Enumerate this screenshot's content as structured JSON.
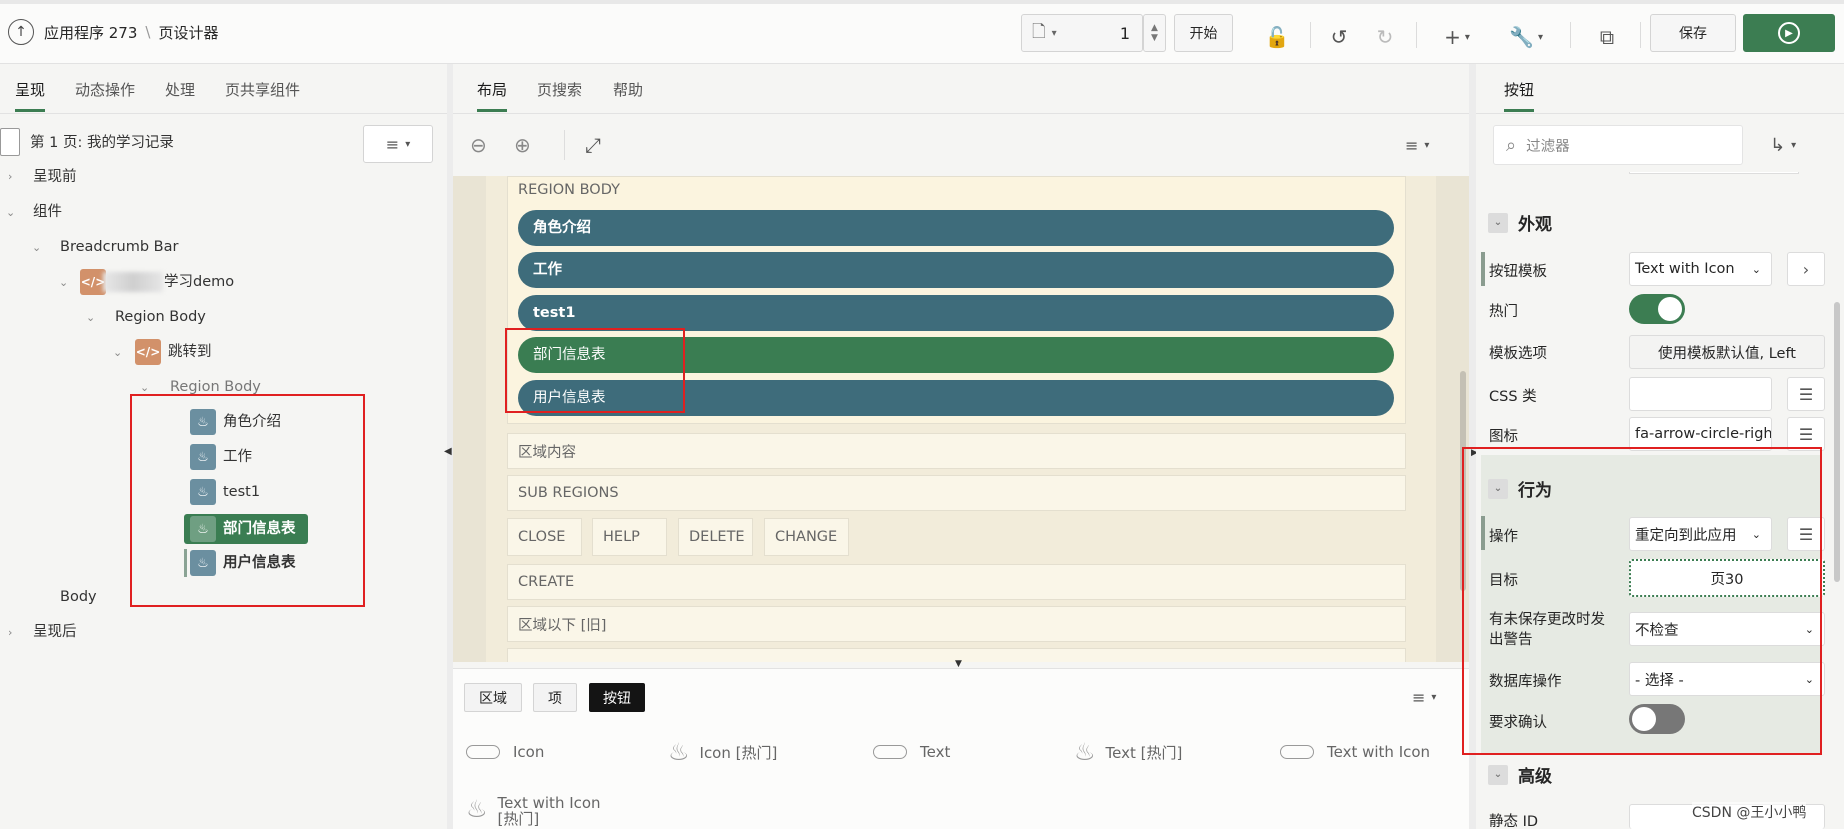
{
  "header": {
    "app_title": "应用程序 273",
    "breadcrumb_sep": "\\",
    "page_designer": "页设计器",
    "page_number": "1",
    "start_label": "开始",
    "save_label": "保存"
  },
  "left_panel": {
    "tabs": [
      "呈现",
      "动态操作",
      "处理",
      "页共享组件"
    ],
    "page_title": "第 1 页: 我的学习记录",
    "tree": {
      "before_render": "呈现前",
      "components": "组件",
      "breadcrumb_bar": "Breadcrumb Bar",
      "demo_region": "学习demo",
      "region_body_1": "Region Body",
      "jump_region": "跳转到",
      "region_body_2": "Region Body",
      "buttons": [
        "角色介绍",
        "工作",
        "test1",
        "部门信息表",
        "用户信息表"
      ],
      "body": "Body",
      "after_render": "呈现后"
    }
  },
  "center": {
    "tabs": [
      "布局",
      "页搜索",
      "帮助"
    ],
    "region_body_label": "REGION BODY",
    "buttons": [
      "角色介绍",
      "工作",
      "test1",
      "部门信息表",
      "用户信息表"
    ],
    "region_content": "区域内容",
    "sub_regions": "SUB REGIONS",
    "sub_buttons": [
      "CLOSE",
      "HELP",
      "DELETE",
      "CHANGE"
    ],
    "create": "CREATE",
    "below_region": "区域以下 [旧]",
    "gallery_tabs": [
      "区域",
      "项",
      "按钮"
    ],
    "gallery_items": [
      "Icon",
      "Icon [热门]",
      "Text",
      "Text [热门]",
      "Text with Icon",
      "Text with Icon [热门]"
    ]
  },
  "right_panel": {
    "tab": "按钮",
    "filter_placeholder": "过滤器",
    "appearance": {
      "title": "外观",
      "button_template_label": "按钮模板",
      "button_template_value": "Text with Icon",
      "hot_label": "热门",
      "hot_value": "on",
      "template_options_label": "模板选项",
      "template_options_value": "使用模板默认值, Left",
      "css_class_label": "CSS 类",
      "css_class_value": "",
      "icon_label": "图标",
      "icon_value": "fa-arrow-circle-righ"
    },
    "behavior": {
      "title": "行为",
      "action_label": "操作",
      "action_value": "重定向到此应用",
      "target_label": "目标",
      "target_value": "页30",
      "warn_label_1": "有未保存更改时发",
      "warn_label_2": "出警告",
      "warn_value": "不检查",
      "db_action_label": "数据库操作",
      "db_action_value": "- 选择 -",
      "confirm_label": "要求确认",
      "confirm_value": "off"
    },
    "advanced": {
      "title": "高级",
      "static_id_label": "静态 ID"
    }
  },
  "watermark": "CSDN @王小小鸭",
  "colors": {
    "accent_green": "#3c7d52",
    "button_teal": "#3e6c7b",
    "selected_green": "#3a7d52",
    "highlight_red": "#e02020"
  }
}
